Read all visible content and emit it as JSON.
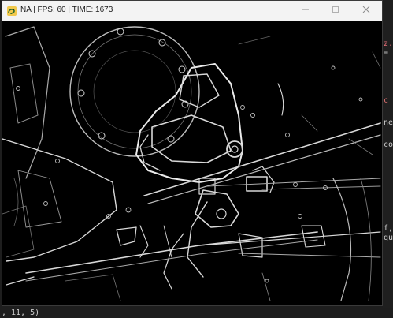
{
  "window": {
    "title": "NA | FPS: 60 | TIME: 1673",
    "minimize_icon": "minimize-icon",
    "maximize_icon": "maximize-icon",
    "close_icon": "close-icon",
    "app_icon": "pygame-snake-icon"
  },
  "viewport": {
    "content": "edge-detection-frame"
  },
  "background": {
    "right_fragments": [
      {
        "text": "z.l",
        "color": "#e06c75"
      },
      {
        "text": "=",
        "color": "#cfcfcf"
      },
      {
        "text": "c",
        "color": "#cfcfcf"
      },
      {
        "text": "new",
        "color": "#cfcfcf"
      },
      {
        "text": "co",
        "color": "#cfcfcf"
      },
      {
        "text": "f,",
        "color": "#cfcfcf"
      },
      {
        "text": "qua",
        "color": "#cfcfcf"
      }
    ],
    "bottom_fragment": ", 11, 5)"
  }
}
